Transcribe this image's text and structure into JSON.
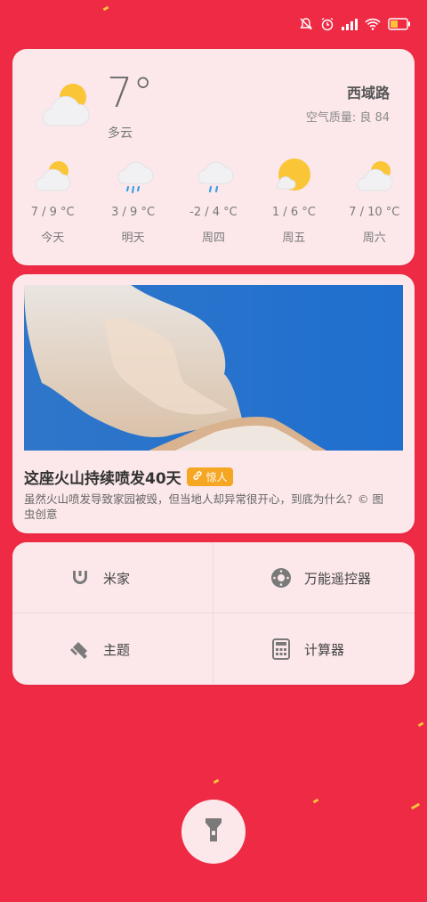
{
  "weather": {
    "current_temp": "7°",
    "condition": "多云",
    "city": "西域路",
    "aqi": "空气质量: 良 84",
    "forecast": [
      {
        "temp": "7 / 9 °C",
        "label": "今天",
        "icon": "partly-cloudy-icon"
      },
      {
        "temp": "3 / 9 °C",
        "label": "明天",
        "icon": "rain-icon"
      },
      {
        "temp": "-2 / 4 °C",
        "label": "周四",
        "icon": "rain-icon"
      },
      {
        "temp": "1 / 6 °C",
        "label": "周五",
        "icon": "sunny-icon"
      },
      {
        "temp": "7 / 10 °C",
        "label": "周六",
        "icon": "partly-cloudy-icon"
      }
    ]
  },
  "news": {
    "title": "这座火山持续喷发40天",
    "tag": "惊人",
    "description": "虽然火山喷发导致家园被毁，但当地人却异常很开心，到底为什么？© 图虫创意"
  },
  "shortcuts": [
    {
      "label": "米家",
      "icon": "mijia-icon"
    },
    {
      "label": "万能遥控器",
      "icon": "remote-control-icon"
    },
    {
      "label": "主题",
      "icon": "theme-brush-icon"
    },
    {
      "label": "计算器",
      "icon": "calculator-icon"
    }
  ],
  "colors": {
    "background": "#EE2A45",
    "card": "#FCE8EA",
    "tag": "#F5A623",
    "sun": "#FAC638"
  }
}
